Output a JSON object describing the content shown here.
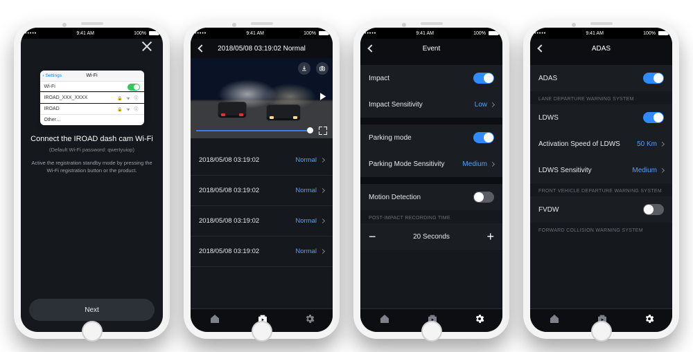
{
  "status": {
    "carrier_dots": "•••••",
    "wifi": "⌵",
    "time": "9:41 AM",
    "pct": "100%",
    "bt": "∗"
  },
  "accent": "#2f8bff",
  "screen1": {
    "close_label": "close",
    "mini": {
      "back": "‹ Settings",
      "title": "Wi-Fi",
      "row_wifi": "Wi-Fi",
      "row_selected": "IROAD_XXX_XXXX",
      "row_other1": "IROAD",
      "row_other2": "Other…"
    },
    "title": "Connect the IROAD dash cam Wi-Fi",
    "subtitle": "(Default Wi-Fi password: qwertyuiop)",
    "desc": "Active the registration standby mode by pressing the Wi-Fi registration button or the product.",
    "next": "Next"
  },
  "screen2": {
    "nav_title": "2018/05/08 03:19:02 Normal",
    "rows": [
      {
        "ts": "2018/05/08 03:19:02",
        "tag": "Normal"
      },
      {
        "ts": "2018/05/08 03:19:02",
        "tag": "Normal"
      },
      {
        "ts": "2018/05/08 03:19:02",
        "tag": "Normal"
      },
      {
        "ts": "2018/05/08 03:19:02",
        "tag": "Normal"
      }
    ]
  },
  "screen3": {
    "nav_title": "Event",
    "group1": [
      {
        "label": "Impact",
        "kind": "toggle",
        "on": true
      },
      {
        "label": "Impact Sensitivity",
        "kind": "value",
        "value": "Low"
      }
    ],
    "group2": [
      {
        "label": "Parking mode",
        "kind": "toggle",
        "on": true
      },
      {
        "label": "Parking Mode Sensitivity",
        "kind": "value",
        "value": "Medium"
      }
    ],
    "group3": [
      {
        "label": "Motion Detection",
        "kind": "toggle",
        "on": false
      }
    ],
    "section_label": "POST-IMPACT RECORDING TIME",
    "stepper_value": "20 Seconds",
    "minus": "−",
    "plus": "+"
  },
  "screen4": {
    "nav_title": "ADAS",
    "g1": [
      {
        "label": "ADAS",
        "kind": "toggle",
        "on": true
      }
    ],
    "s1": "LANE DEPARTURE WARNING SYSTEM",
    "g2": [
      {
        "label": "LDWS",
        "kind": "toggle",
        "on": true
      },
      {
        "label": "Activation Speed of LDWS",
        "kind": "value",
        "value": "50 Km"
      },
      {
        "label": "LDWS Sensitivity",
        "kind": "value",
        "value": "Medium"
      }
    ],
    "s2": "FRONT VEHICLE DEPARTURE WARNING SYSTEM",
    "g3": [
      {
        "label": "FVDW",
        "kind": "toggle",
        "on": false
      }
    ],
    "s3": "FORWARD COLLISION WARNING SYSTEM"
  }
}
